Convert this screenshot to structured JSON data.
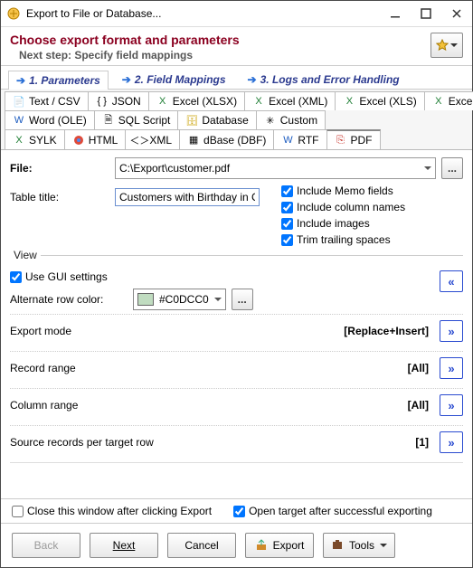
{
  "window": {
    "title": "Export to File or Database..."
  },
  "header": {
    "title": "Choose export format and parameters",
    "subtitle": "Next step: Specify field mappings"
  },
  "mainTabs": [
    "1. Parameters",
    "2. Field Mappings",
    "3. Logs and Error Handling"
  ],
  "formats": {
    "row1": [
      "Text / CSV",
      "JSON",
      "Excel (XLSX)",
      "Excel (XML)",
      "Excel (XLS)",
      "Excel (OLE)"
    ],
    "row2": [
      "Word (OLE)",
      "SQL Script",
      "Database",
      "Custom"
    ],
    "row3": [
      "SYLK",
      "HTML",
      "XML",
      "dBase (DBF)",
      "RTF",
      "PDF"
    ]
  },
  "fileLabel": "File:",
  "fileValue": "C:\\Export\\customer.pdf",
  "titleLabel": "Table title:",
  "titleValue": "Customers with Birthday in Current Month",
  "opts": {
    "memo": "Include Memo fields",
    "cols": "Include column names",
    "imgs": "Include images",
    "trim": "Trim trailing spaces"
  },
  "view": {
    "label": "View",
    "usegui": "Use GUI settings",
    "altrow": "Alternate row color:",
    "color": "#C0DCC0"
  },
  "kv": {
    "mode": {
      "k": "Export mode",
      "v": "[Replace+Insert]"
    },
    "rrange": {
      "k": "Record range",
      "v": "[All]"
    },
    "crange": {
      "k": "Column range",
      "v": "[All]"
    },
    "srct": {
      "k": "Source records per target row",
      "v": "[1]"
    }
  },
  "bottom": {
    "close": "Close this window after clicking Export",
    "open": "Open target after successful exporting"
  },
  "buttons": {
    "back": "Back",
    "next": "Next",
    "cancel": "Cancel",
    "export": "Export",
    "tools": "Tools"
  },
  "ellipsis": "..."
}
